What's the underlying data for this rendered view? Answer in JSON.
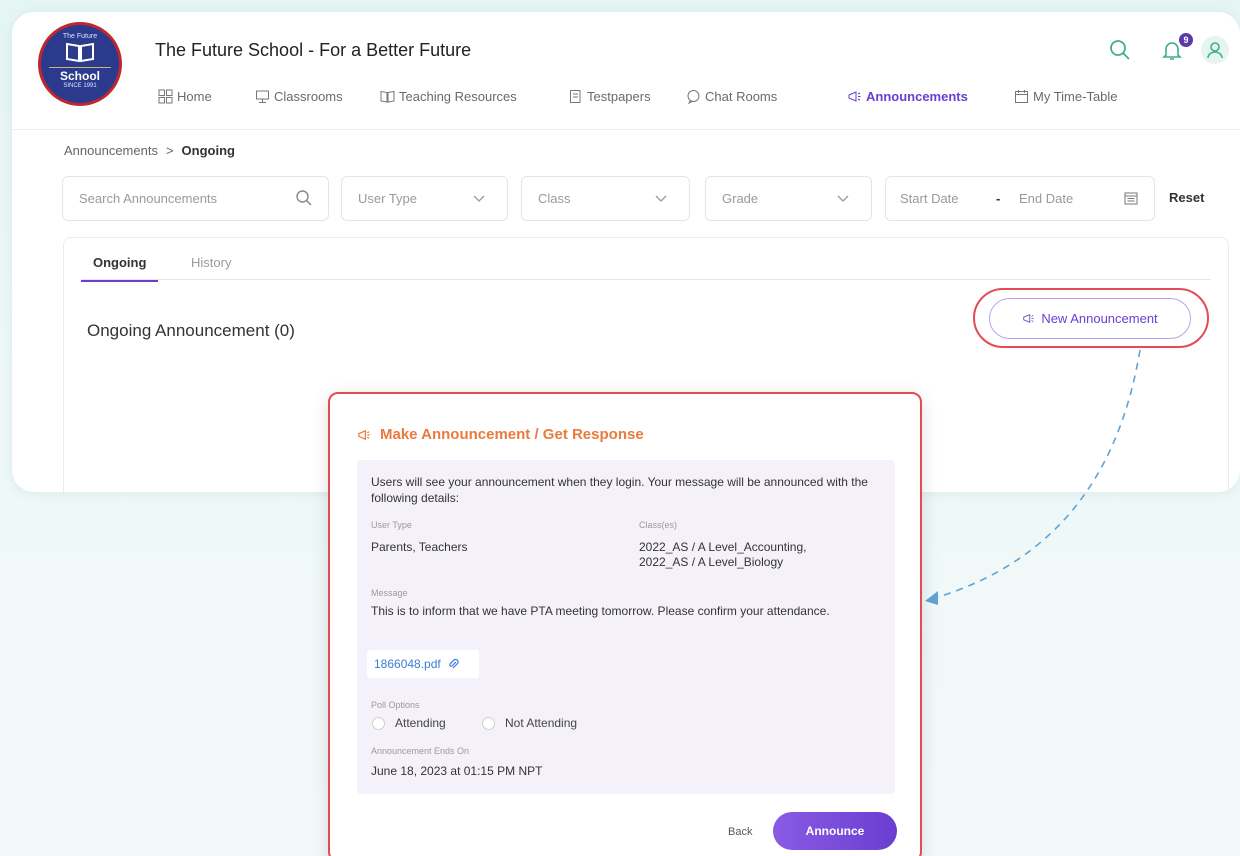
{
  "header": {
    "school_title": "The Future School - For a Better Future",
    "logo": {
      "top_text": "The Future",
      "name": "School",
      "since": "SINCE 1991"
    },
    "notification_count": "9",
    "icons": [
      "search-icon",
      "bell-icon",
      "user-icon"
    ]
  },
  "nav": {
    "items": [
      {
        "label": "Home",
        "icon": "grid-icon"
      },
      {
        "label": "Classrooms",
        "icon": "board-icon"
      },
      {
        "label": "Teaching Resources",
        "icon": "book-icon"
      },
      {
        "label": "Testpapers",
        "icon": "paper-icon"
      },
      {
        "label": "Chat Rooms",
        "icon": "chat-icon"
      },
      {
        "label": "Announcements",
        "icon": "megaphone-icon",
        "active": true
      },
      {
        "label": "My Time-Table",
        "icon": "calendar-icon"
      }
    ]
  },
  "breadcrumb": {
    "parent": "Announcements",
    "separator": ">",
    "current": "Ongoing"
  },
  "filters": {
    "search_placeholder": "Search Announcements",
    "user_type": "User Type",
    "class": "Class",
    "grade": "Grade",
    "start_date": "Start Date",
    "date_separator": "-",
    "end_date": "End Date",
    "reset": "Reset"
  },
  "tabs": {
    "ongoing": "Ongoing",
    "history": "History"
  },
  "panel": {
    "title": "Ongoing Announcement (0)",
    "new_button": "New Announcement"
  },
  "modal": {
    "title": "Make Announcement / Get Response",
    "intro": "Users will see your announcement when they login. Your message will be announced with the following details:",
    "user_type_label": "User Type",
    "user_type_value": "Parents, Teachers",
    "classes_label": "Class(es)",
    "classes_line1": "2022_AS / A Level_Accounting,",
    "classes_line2": "2022_AS / A Level_Biology",
    "message_label": "Message",
    "message_value": "This is to inform that we have PTA meeting tomorrow. Please confirm your attendance.",
    "attachment": "1866048.pdf",
    "poll_label": "Poll Options",
    "poll_options": [
      "Attending",
      "Not Attending"
    ],
    "ends_label": "Announcement Ends On",
    "ends_value": "June 18, 2023 at 01:15 PM NPT",
    "back": "Back",
    "announce": "Announce"
  },
  "colors": {
    "accent": "#6a3ed0",
    "highlight": "#e34b55",
    "modal_title": "#e97b3c",
    "link": "#3a7ed8"
  }
}
